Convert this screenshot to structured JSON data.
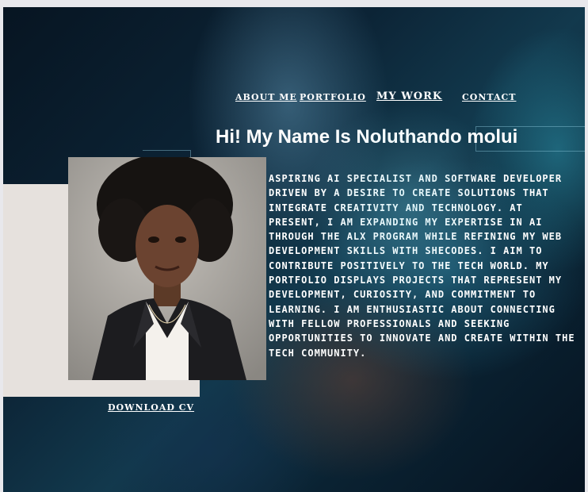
{
  "nav": {
    "about": "ABOUT ME",
    "portfolio": "PORTFOLIO",
    "my_work": "MY WORK",
    "contact": "CONTACT"
  },
  "hero": {
    "title": "Hi! My Name Is Noluthando molui",
    "bio": "Aspiring AI Specialist and Software Developer driven by a desire to create solutions that integrate creativity and technology. At present, I am expanding my expertise in AI through the ALX program while refining my web development skills with SheCodes. I aim to contribute positively to the tech world. My portfolio displays projects that represent my development, curiosity, and commitment to learning. I am enthusiastic about connecting with fellow professionals and seeking opportunities to innovate and create within the tech community."
  },
  "cta": {
    "download_cv": "DOWNLOAD CV"
  },
  "colors": {
    "text": "#ffffff",
    "backdrop": "#e6e1dd",
    "background_dark": "#0c2436"
  }
}
